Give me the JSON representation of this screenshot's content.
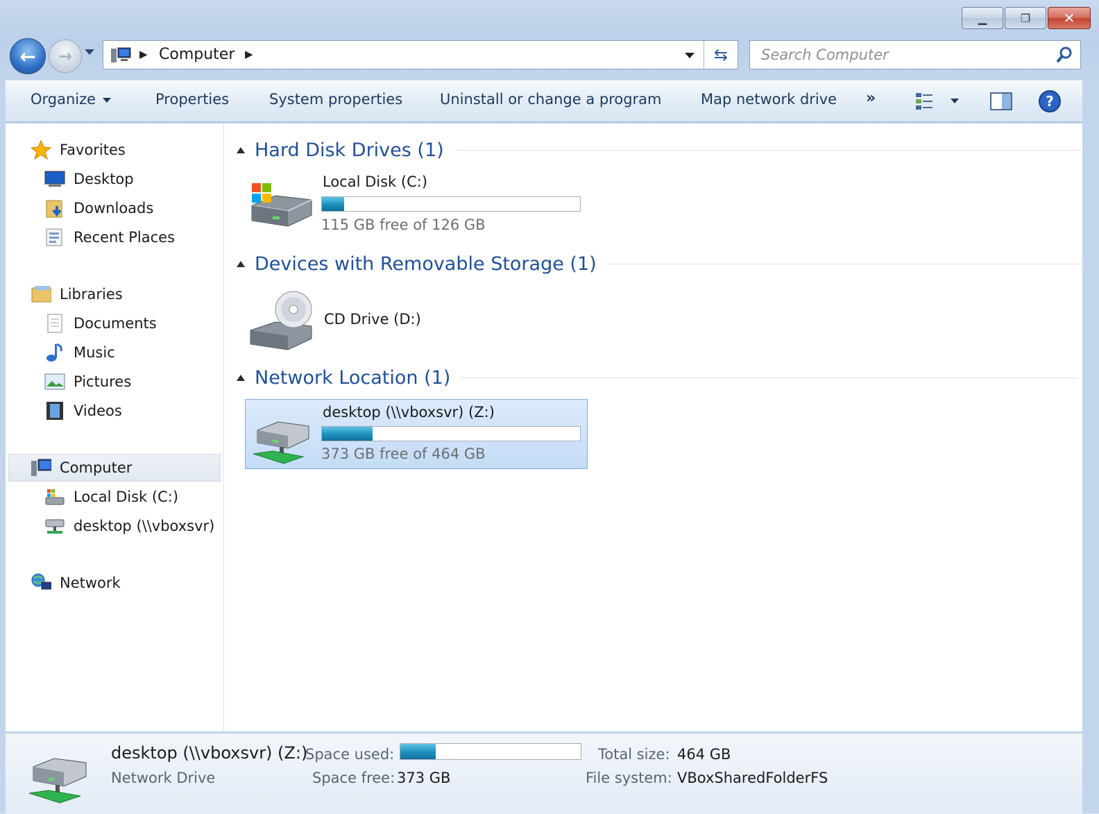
{
  "window": {
    "caption_buttons": {
      "minimize": "▁",
      "restore": "❐",
      "close": "✕"
    }
  },
  "address_bar": {
    "breadcrumb": "Computer",
    "search_placeholder": "Search Computer"
  },
  "toolbar": {
    "organize": "Organize",
    "properties": "Properties",
    "system_properties": "System properties",
    "uninstall": "Uninstall or change a program",
    "map_drive": "Map network drive",
    "more": "»"
  },
  "nav": {
    "favorites": "Favorites",
    "desktop": "Desktop",
    "downloads": "Downloads",
    "recent_places": "Recent Places",
    "libraries": "Libraries",
    "documents": "Documents",
    "music": "Music",
    "pictures": "Pictures",
    "videos": "Videos",
    "computer": "Computer",
    "local_disk": "Local Disk (C:)",
    "desktop_share": "desktop (\\\\vboxsvr)",
    "network": "Network"
  },
  "groups": {
    "hard_disk": "Hard Disk Drives (1)",
    "removable": "Devices with Removable Storage (1)",
    "network": "Network Location (1)"
  },
  "drives": {
    "c": {
      "name": "Local Disk (C:)",
      "free_text": "115 GB free of 126 GB",
      "used_fraction": 0.087
    },
    "d": {
      "name": "CD Drive (D:)"
    },
    "z": {
      "name": "desktop (\\\\vboxsvr) (Z:)",
      "free_text": "373 GB free of 464 GB",
      "used_fraction": 0.196
    }
  },
  "details": {
    "name": "desktop (\\\\vboxsvr) (Z:)",
    "type": "Network Drive",
    "space_used_label": "Space used:",
    "space_free_label": "Space free:",
    "space_free_value": "373 GB",
    "total_size_label": "Total size:",
    "total_size_value": "464 GB",
    "file_system_label": "File system:",
    "file_system_value": "VBoxSharedFolderFS",
    "used_fraction": 0.196
  },
  "colors": {
    "group_heading": "#1f4f9c",
    "usage_bar": "#1c8fbf",
    "selection": "#c4dcf6"
  }
}
